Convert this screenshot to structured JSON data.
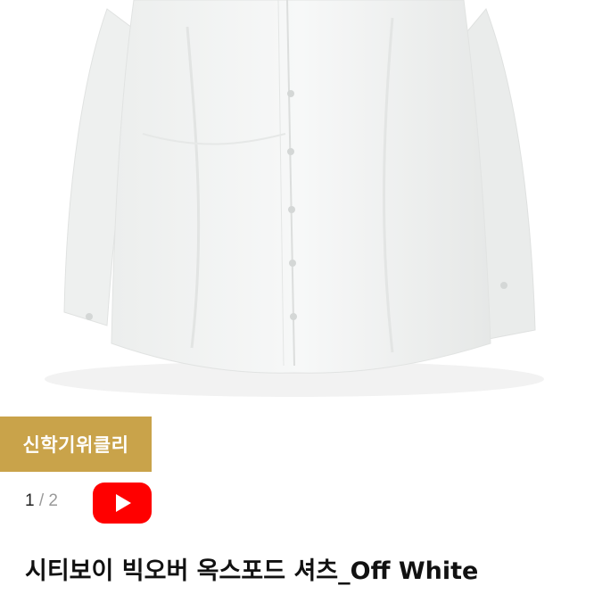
{
  "product": {
    "badge": "신학기위클리",
    "image_counter": {
      "current": "1",
      "separator": "/",
      "total": "2"
    },
    "title": "시티보이 빅오버 옥스포드 셔츠_Off White"
  },
  "colors": {
    "badge_bg": "#c9a34a",
    "youtube_red": "#ff0000"
  },
  "icons": {
    "video": "youtube-play-icon"
  }
}
